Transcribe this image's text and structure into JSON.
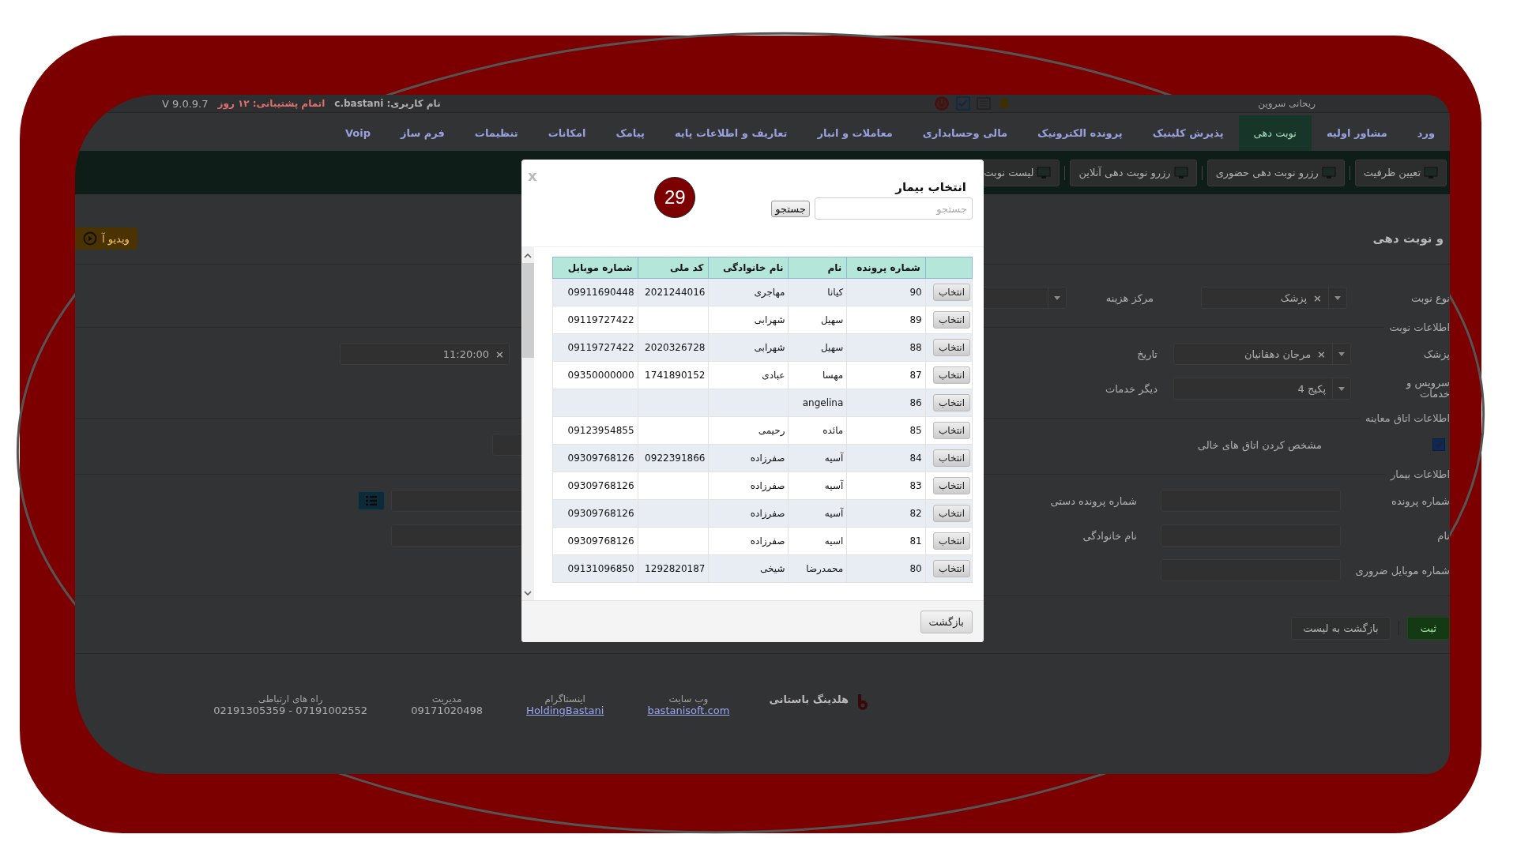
{
  "top_bar": {
    "version": "V 9.0.9.7",
    "support": "اتمام پشتیبانی: ۱۲ روز",
    "username": "نام کاربری: c.bastani",
    "user": "ریحانی سروین"
  },
  "menu": [
    {
      "label": "ورد",
      "selected": false
    },
    {
      "label": "مشاور اولیه",
      "selected": false
    },
    {
      "label": "نوبت دهی",
      "selected": true
    },
    {
      "label": "پذیرش کلینیک",
      "selected": false
    },
    {
      "label": "پرونده الکترونیک",
      "selected": false
    },
    {
      "label": "مالی وحسابداری",
      "selected": false
    },
    {
      "label": "معاملات و انبار",
      "selected": false
    },
    {
      "label": "تعاریف و اطلاعات پایه",
      "selected": false
    },
    {
      "label": "پیامک",
      "selected": false
    },
    {
      "label": "امکانات",
      "selected": false
    },
    {
      "label": "تنظیمات",
      "selected": false
    },
    {
      "label": "فرم ساز",
      "selected": false
    },
    {
      "label": "Voip",
      "selected": false
    }
  ],
  "toolbar": [
    "تعیین ظرفیت",
    "رزرو نوبت دهی حضوری",
    "رزرو نوبت دهی آنلاین",
    "لیست نوبت"
  ],
  "page": {
    "title": "و نوبت دهی",
    "video_button": "ویدیو آ"
  },
  "form": {
    "appointment_type": {
      "label": "نوع نوبت",
      "value": "پزشک",
      "clear": "×"
    },
    "cost_center": {
      "label": "مرکز هزینه"
    },
    "section_appointment": "اطلاعات نوبت",
    "doctor": {
      "label": "پزشک",
      "value": "مرجان دهقانیان",
      "clear": "×"
    },
    "date": {
      "label": "تاریخ",
      "value": "11:20:00",
      "clear": "×"
    },
    "services": {
      "label": "سرویس و خدمات",
      "value": "پکیج 4"
    },
    "other_services": {
      "label": "دیگر خدمات"
    },
    "section_room": "اطلاعات اتاق معاینه",
    "empty_rooms": {
      "label": "مشخص کردن اتاق های خالی",
      "checked": true
    },
    "section_patient": "اطلاعات بیمار",
    "file_number": {
      "label": "شماره پرونده"
    },
    "manual_file_number": {
      "label": "شماره پرونده دستی"
    },
    "first_name": {
      "label": "نام"
    },
    "last_name": {
      "label": "نام خانوادگی"
    },
    "mobile": {
      "label": "شماره موبایل ضروری"
    },
    "submit": "ثبت",
    "back": "بازگشت به لیست"
  },
  "footer": {
    "brand": "هلدینگ باستانی",
    "columns": [
      {
        "title": "وب سایت",
        "value": "bastanisoft.com",
        "link": true
      },
      {
        "title": "اینستاگرام",
        "value": "HoldingBastani",
        "link": true
      },
      {
        "title": "مدیریت",
        "value": "09171020498",
        "link": false
      },
      {
        "title": "راه های ارتباطی",
        "value": "07191002552 - 02191305359",
        "link": false
      }
    ]
  },
  "modal": {
    "close": "x",
    "title": "انتخاب بیمار",
    "search_placeholder": "جستجو",
    "search_button": "جستجو",
    "badge": "29",
    "columns": [
      "شماره پرونده",
      "نام",
      "نام خانوادگی",
      "کد ملی",
      "شماره موبایل"
    ],
    "rows": [
      {
        "action": "انتخاب",
        "file": "90",
        "name": "کیانا",
        "family": "مهاجری",
        "national_id": "2021244016",
        "mobile": "09911690448"
      },
      {
        "action": "انتخاب",
        "file": "89",
        "name": "سهیل",
        "family": "شهرابی",
        "mobile": "09119727422"
      },
      {
        "action": "انتخاب",
        "file": "88",
        "name": "سهیل",
        "family": "شهرابی",
        "national_id": "2020326728",
        "mobile": "09119727422"
      },
      {
        "action": "انتخاب",
        "file": "87",
        "name": "مهسا",
        "family": "عبادی",
        "national_id": "1741890152",
        "mobile": "09350000000"
      },
      {
        "action": "انتخاب",
        "file": "86",
        "name": "angelina"
      },
      {
        "action": "انتخاب",
        "file": "85",
        "name": "مائده",
        "family": "رحیمی",
        "mobile": "09123954855"
      },
      {
        "action": "انتخاب",
        "file": "84",
        "name": "آسیه",
        "family": "صفرزاده",
        "national_id": "0922391866",
        "mobile": "09309768126"
      },
      {
        "action": "انتخاب",
        "file": "83",
        "name": "آسیه",
        "family": "صفرزاده",
        "mobile": "09309768126"
      },
      {
        "action": "انتخاب",
        "file": "82",
        "name": "آسیه",
        "family": "صفرزاده",
        "mobile": "09309768126"
      },
      {
        "action": "انتخاب",
        "file": "81",
        "name": "اسیه",
        "family": "صفرزاده",
        "mobile": "09309768126"
      },
      {
        "action": "انتخاب",
        "file": "80",
        "name": "محمدرضا",
        "family": "شیخی",
        "national_id": "1292820187",
        "mobile": "09131096850"
      }
    ],
    "back_button": "بازگشت"
  }
}
